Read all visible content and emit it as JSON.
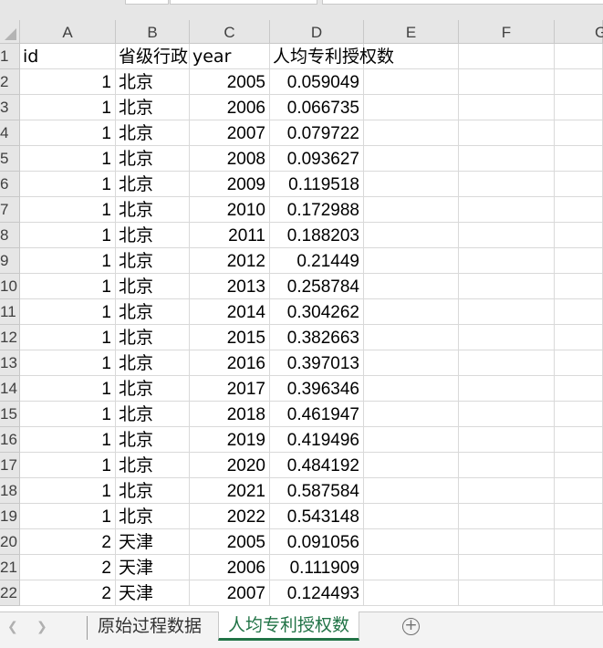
{
  "columns": [
    "A",
    "B",
    "C",
    "D",
    "E",
    "F",
    "G"
  ],
  "rows": [
    {
      "num": "1",
      "id": "id",
      "prov": "省级行政",
      "year": "year",
      "val": "人均专利授权数"
    },
    {
      "num": "2",
      "id": "1",
      "prov": "北京",
      "year": "2005",
      "val": "0.059049"
    },
    {
      "num": "3",
      "id": "1",
      "prov": "北京",
      "year": "2006",
      "val": "0.066735"
    },
    {
      "num": "4",
      "id": "1",
      "prov": "北京",
      "year": "2007",
      "val": "0.079722"
    },
    {
      "num": "5",
      "id": "1",
      "prov": "北京",
      "year": "2008",
      "val": "0.093627"
    },
    {
      "num": "6",
      "id": "1",
      "prov": "北京",
      "year": "2009",
      "val": "0.119518"
    },
    {
      "num": "7",
      "id": "1",
      "prov": "北京",
      "year": "2010",
      "val": "0.172988"
    },
    {
      "num": "8",
      "id": "1",
      "prov": "北京",
      "year": "2011",
      "val": "0.188203"
    },
    {
      "num": "9",
      "id": "1",
      "prov": "北京",
      "year": "2012",
      "val": "0.21449"
    },
    {
      "num": "10",
      "id": "1",
      "prov": "北京",
      "year": "2013",
      "val": "0.258784"
    },
    {
      "num": "11",
      "id": "1",
      "prov": "北京",
      "year": "2014",
      "val": "0.304262"
    },
    {
      "num": "12",
      "id": "1",
      "prov": "北京",
      "year": "2015",
      "val": "0.382663"
    },
    {
      "num": "13",
      "id": "1",
      "prov": "北京",
      "year": "2016",
      "val": "0.397013"
    },
    {
      "num": "14",
      "id": "1",
      "prov": "北京",
      "year": "2017",
      "val": "0.396346"
    },
    {
      "num": "15",
      "id": "1",
      "prov": "北京",
      "year": "2018",
      "val": "0.461947"
    },
    {
      "num": "16",
      "id": "1",
      "prov": "北京",
      "year": "2019",
      "val": "0.419496"
    },
    {
      "num": "17",
      "id": "1",
      "prov": "北京",
      "year": "2020",
      "val": "0.484192"
    },
    {
      "num": "18",
      "id": "1",
      "prov": "北京",
      "year": "2021",
      "val": "0.587584"
    },
    {
      "num": "19",
      "id": "1",
      "prov": "北京",
      "year": "2022",
      "val": "0.543148"
    },
    {
      "num": "20",
      "id": "2",
      "prov": "天津",
      "year": "2005",
      "val": "0.091056"
    },
    {
      "num": "21",
      "id": "2",
      "prov": "天津",
      "year": "2006",
      "val": "0.111909"
    },
    {
      "num": "22",
      "id": "2",
      "prov": "天津",
      "year": "2007",
      "val": "0.124493"
    }
  ],
  "sheets": [
    {
      "label": "原始过程数据",
      "active": false
    },
    {
      "label": "人均专利授权数",
      "active": true
    }
  ],
  "icons": {
    "nav_prev": "chevron-left-icon",
    "nav_next": "chevron-right-icon",
    "add_sheet": "plus-circle-icon"
  },
  "colors": {
    "active_tab": "#217346",
    "header_bg": "#e6e6e6",
    "grid": "#d9d9d9"
  }
}
